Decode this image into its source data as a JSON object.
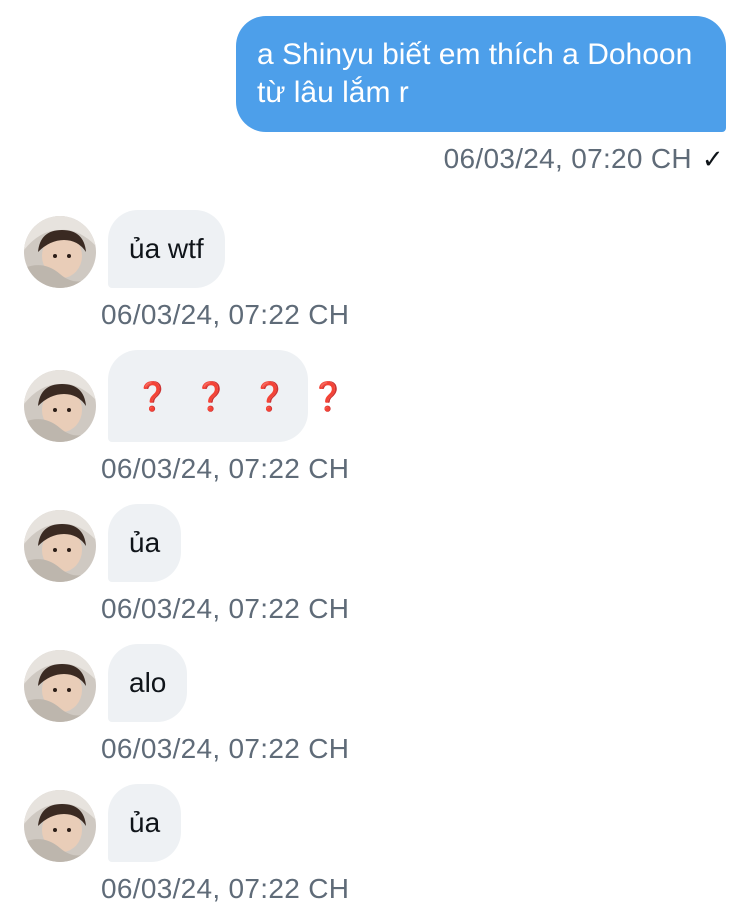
{
  "conversation": {
    "sent": {
      "text": "a Shinyu biết em thích a Dohoon từ lâu lắm r",
      "timestamp": "06/03/24, 07:20 CH",
      "status_icon": "checkmark-icon",
      "status_glyph": "✓",
      "bubble_color": "#4d9fea"
    },
    "received": [
      {
        "text": "ủa wtf",
        "timestamp": "06/03/24, 07:22 CH"
      },
      {
        "text": "❓ ❓ ❓ ❓",
        "timestamp": "06/03/24, 07:22 CH"
      },
      {
        "text": "ủa",
        "timestamp": "06/03/24, 07:22 CH"
      },
      {
        "text": "alo",
        "timestamp": "06/03/24, 07:22 CH"
      },
      {
        "text": "ủa",
        "timestamp": "06/03/24, 07:22 CH"
      }
    ],
    "received_bubble_color": "#eef1f4",
    "timestamp_color": "#5f6b78"
  }
}
